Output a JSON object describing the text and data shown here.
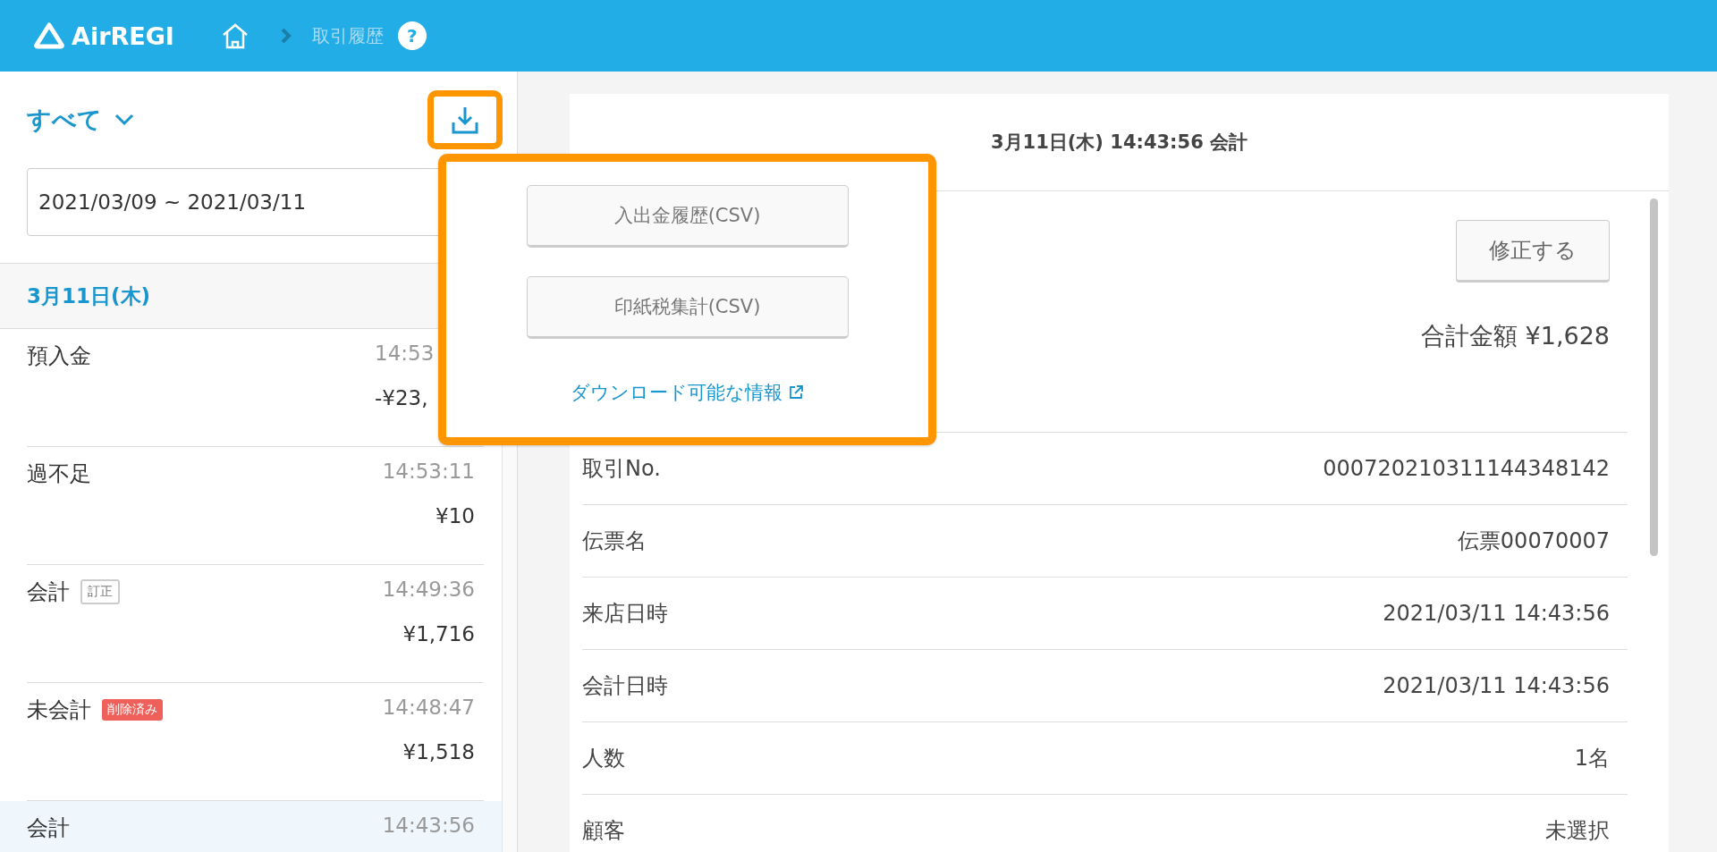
{
  "header": {
    "logo": "AirREGI",
    "breadcrumb": "取引履歴",
    "help": "?"
  },
  "sidebar": {
    "filter": "すべて",
    "download_highlighted": true,
    "date_range": "2021/03/09 ~ 2021/03/11",
    "date_heading": "3月11日(木)",
    "items": [
      {
        "label": "預入金",
        "time": "14:53",
        "amount": "-¥23,",
        "selected": false
      },
      {
        "label": "過不足",
        "time": "14:53:11",
        "amount": "¥10",
        "selected": false
      },
      {
        "label": "会計",
        "badge": {
          "text": "訂正",
          "kind": "outline"
        },
        "time": "14:49:36",
        "amount": "¥1,716",
        "selected": false
      },
      {
        "label": "未会計",
        "badge": {
          "text": "削除済み",
          "kind": "danger"
        },
        "time": "14:48:47",
        "amount": "¥1,518",
        "selected": false
      },
      {
        "label": "会計",
        "time": "14:43:56",
        "selected": true
      }
    ]
  },
  "download_menu": {
    "highlighted": true,
    "buttons": [
      "入出金履歴(CSV)",
      "印紙税集計(CSV)"
    ],
    "link": "ダウンロード可能な情報"
  },
  "detail": {
    "title": "3月11日(木) 14:43:56 会計",
    "edit_button": "修正する",
    "total": "合計金額 ¥1,628",
    "rows": [
      {
        "label": "取引No.",
        "value": "000720210311144348142"
      },
      {
        "label": "伝票名",
        "value": "伝票00070007"
      },
      {
        "label": "来店日時",
        "value": "2021/03/11 14:43:56"
      },
      {
        "label": "会計日時",
        "value": "2021/03/11 14:43:56"
      },
      {
        "label": "人数",
        "value": "1名"
      },
      {
        "label": "顧客",
        "value": "未選択"
      }
    ]
  }
}
